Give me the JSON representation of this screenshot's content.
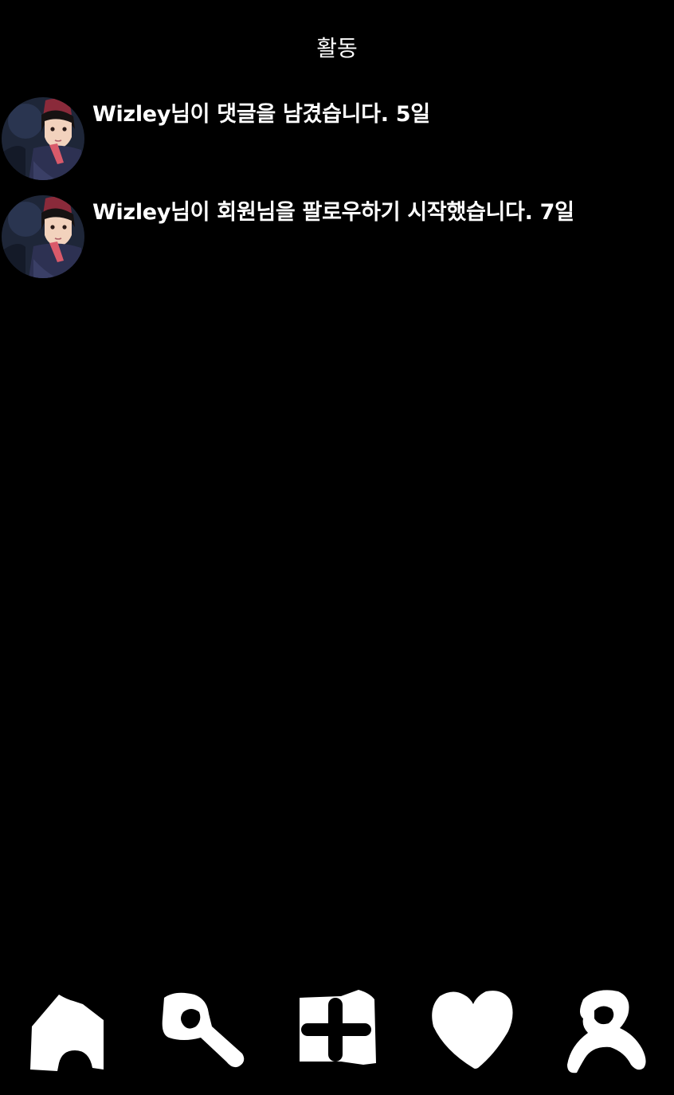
{
  "header": {
    "title": "활동"
  },
  "activities": [
    {
      "avatar_icon": "user-avatar-icon",
      "text": "Wizley님이 댓글을 남겼습니다. 5일"
    },
    {
      "avatar_icon": "user-avatar-icon",
      "text": "Wizley님이 회원님을 팔로우하기 시작했습니다. 7일"
    }
  ],
  "bottom_nav": {
    "items": [
      {
        "icon": "home-icon"
      },
      {
        "icon": "search-icon"
      },
      {
        "icon": "add-post-icon"
      },
      {
        "icon": "heart-icon"
      },
      {
        "icon": "profile-icon"
      }
    ]
  },
  "colors": {
    "background": "#000000",
    "text": "#ffffff",
    "icon": "#ffffff"
  }
}
